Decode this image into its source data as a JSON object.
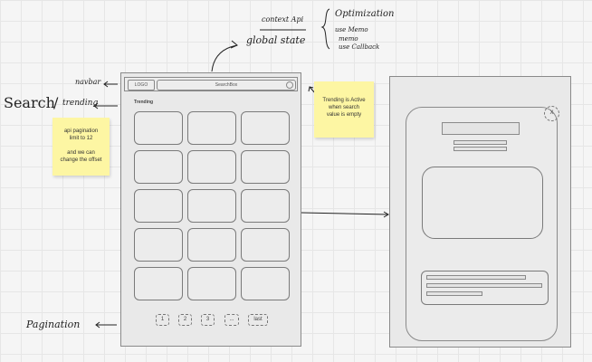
{
  "annotations": {
    "context_api": "context Api",
    "global_state": "global state",
    "optimization": "Optimization",
    "use_memo": "use Memo",
    "memo": "memo",
    "use_callback": "use Callback",
    "navbar": "navbar",
    "search": "Search",
    "trending": "trending",
    "pagination": "Pagination"
  },
  "sticky_notes": {
    "api_pagination": {
      "line1": "api pagination",
      "line2": "limit to 12",
      "line3": "and we can",
      "line4": "change the offset"
    },
    "trending_active": {
      "line1": "Trending is Active",
      "line2": "when search",
      "line3": "value is empty"
    }
  },
  "main_frame": {
    "logo": "LOGO",
    "search_box": "SearchBox",
    "section_title": "Trending",
    "card_count": 15,
    "pagination": [
      "1",
      "2",
      "3",
      "...",
      "last"
    ]
  },
  "detail_frame": {
    "close": "X"
  },
  "colors": {
    "sticky": "#fdf6a3",
    "frame": "#e9e9e9",
    "stroke": "#8a8a8a"
  }
}
